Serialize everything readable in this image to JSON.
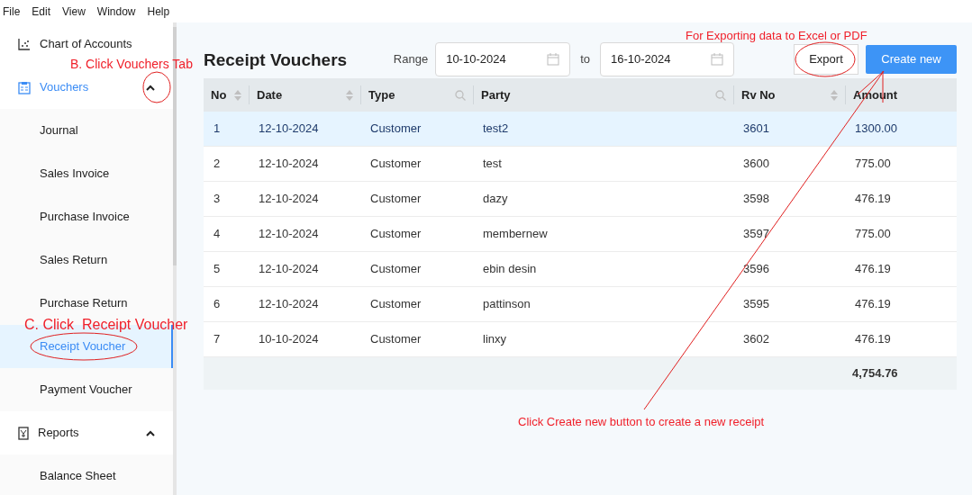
{
  "menu_bar": [
    "File",
    "Edit",
    "View",
    "Window",
    "Help"
  ],
  "sidebar": {
    "items": [
      {
        "label": "Chart of Accounts",
        "kind": "chart",
        "selected": false
      },
      {
        "label": "Vouchers",
        "kind": "vouchers",
        "selected": true,
        "expanded": true,
        "children": [
          {
            "label": "Journal",
            "selected": false
          },
          {
            "label": "Sales Invoice",
            "selected": false
          },
          {
            "label": "Purchase Invoice",
            "selected": false
          },
          {
            "label": "Sales Return",
            "selected": false
          },
          {
            "label": "Purchase Return",
            "selected": false
          },
          {
            "label": "Receipt Voucher",
            "selected": true
          },
          {
            "label": "Payment Voucher",
            "selected": false
          }
        ]
      },
      {
        "label": "Reports",
        "kind": "reports",
        "selected": false,
        "expanded": true,
        "children": [
          {
            "label": "Balance Sheet",
            "selected": false
          }
        ]
      }
    ]
  },
  "page": {
    "title": "Receipt Vouchers",
    "range_label": "Range",
    "from_date": "10-10-2024",
    "to_label": "to",
    "to_date": "16-10-2024",
    "export_button": "Export",
    "create_button": "Create new"
  },
  "table": {
    "columns": [
      {
        "label": "No",
        "kind": "sort"
      },
      {
        "label": "Date",
        "kind": "sort"
      },
      {
        "label": "Type",
        "kind": "search"
      },
      {
        "label": "Party",
        "kind": "search"
      },
      {
        "label": "Rv No",
        "kind": "sort"
      },
      {
        "label": "Amount",
        "kind": "plain"
      }
    ],
    "rows": [
      {
        "cells": [
          "1",
          "12-10-2024",
          "Customer",
          "test2",
          "3601",
          "1300.00"
        ],
        "selected": true
      },
      {
        "cells": [
          "2",
          "12-10-2024",
          "Customer",
          "test",
          "3600",
          "775.00"
        ],
        "selected": false
      },
      {
        "cells": [
          "3",
          "12-10-2024",
          "Customer",
          "dazy",
          "3598",
          "476.19"
        ],
        "selected": false
      },
      {
        "cells": [
          "4",
          "12-10-2024",
          "Customer",
          "membernew",
          "3597",
          "775.00"
        ],
        "selected": false
      },
      {
        "cells": [
          "5",
          "12-10-2024",
          "Customer",
          "ebin desin",
          "3596",
          "476.19"
        ],
        "selected": false
      },
      {
        "cells": [
          "6",
          "12-10-2024",
          "Customer",
          "pattinson",
          "3595",
          "476.19"
        ],
        "selected": false
      },
      {
        "cells": [
          "7",
          "10-10-2024",
          "Customer",
          "linxy",
          "3602",
          "476.19"
        ],
        "selected": false
      }
    ],
    "total": "4,754.76"
  },
  "annotations": [
    "B. Click Vouchers Tab",
    "C. Click  Receipt Voucher",
    "For Exporting data to Excel or PDF",
    "Click Create new button to create a new receipt"
  ]
}
